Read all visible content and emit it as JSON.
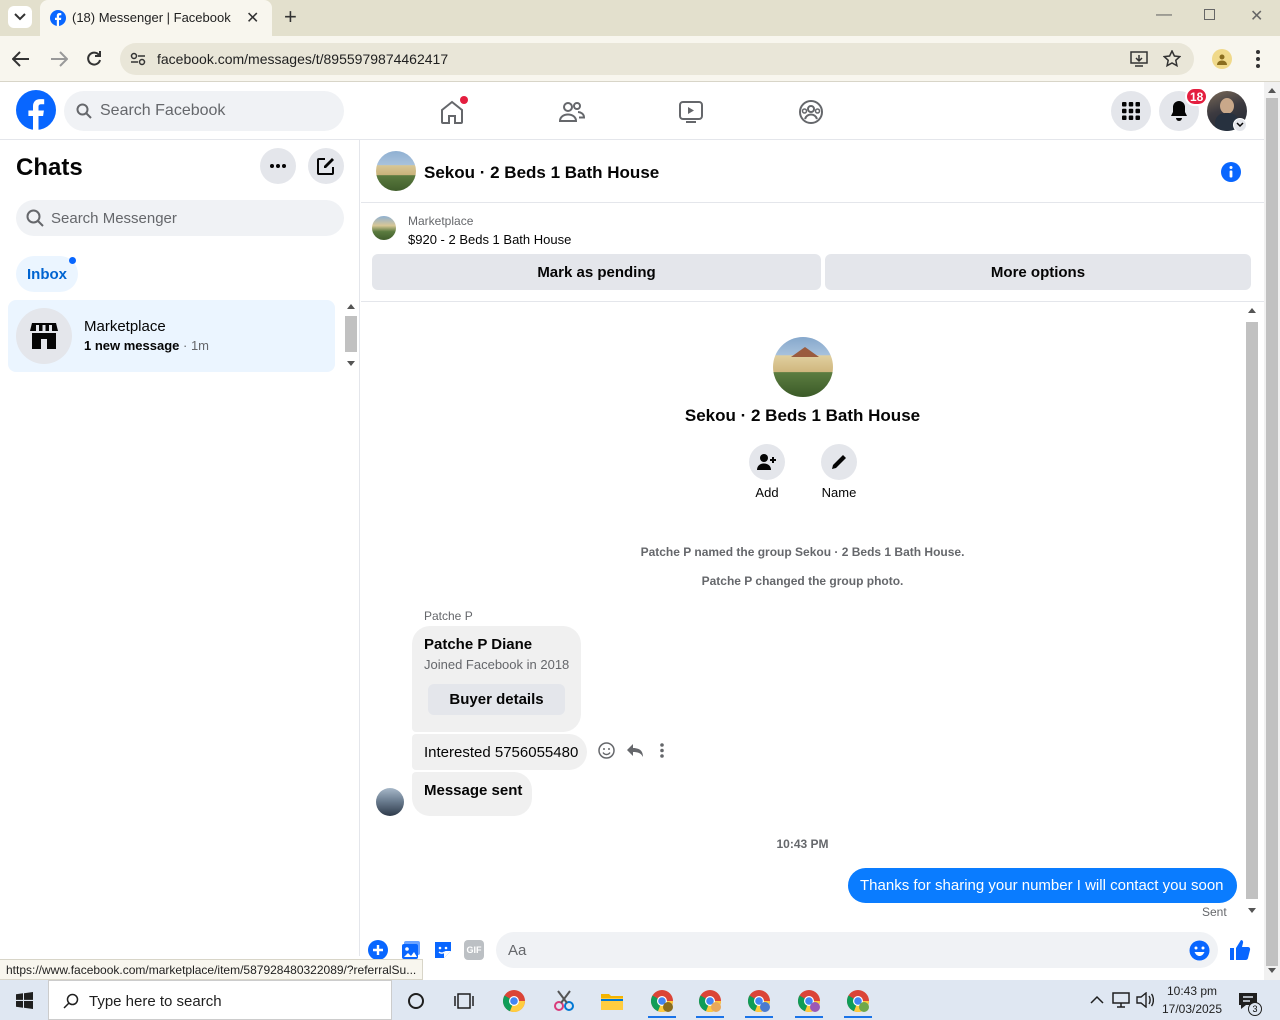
{
  "browser": {
    "tab_title": "(18) Messenger | Facebook",
    "url": "facebook.com/messages/t/8955979874462417",
    "status_url": "https://www.facebook.com/marketplace/item/587928480322089/?referralSu..."
  },
  "fb_header": {
    "search_placeholder": "Search Facebook",
    "notification_count": "18"
  },
  "sidebar": {
    "title": "Chats",
    "search_placeholder": "Search Messenger",
    "filter_label": "Inbox",
    "chats": [
      {
        "name": "Marketplace",
        "preview": "1 new message",
        "time": "1m"
      }
    ]
  },
  "conversation": {
    "title": "Sekou · 2 Beds 1 Bath House",
    "listing": {
      "source": "Marketplace",
      "price_title": "$920 - 2 Beds 1 Bath House",
      "mark_pending_label": "Mark as pending",
      "more_options_label": "More options"
    },
    "profile": {
      "name": "Sekou · 2 Beds 1 Bath House",
      "add_label": "Add",
      "name_label": "Name"
    },
    "system_messages": [
      "Patche P named the group Sekou · 2 Beds 1 Bath House.",
      "Patche P changed the group photo."
    ],
    "sender_name": "Patche P",
    "buyer_card": {
      "name": "Patche P Diane",
      "joined": "Joined Facebook in 2018",
      "button": "Buyer details"
    },
    "incoming": [
      "Interested 5756055480",
      "Message sent"
    ],
    "timestamp": "10:43 PM",
    "outgoing": "Thanks for sharing your number I will contact you soon",
    "status": "Sent",
    "composer_placeholder": "Aa",
    "gif_label": "GIF"
  },
  "taskbar": {
    "search_placeholder": "Type here to search",
    "time": "10:43 pm",
    "date": "17/03/2025",
    "notification_count": "3"
  },
  "colors": {
    "brand": "#0866ff",
    "messenger_blue": "#0a7cff",
    "badge_red": "#e41e3f"
  }
}
